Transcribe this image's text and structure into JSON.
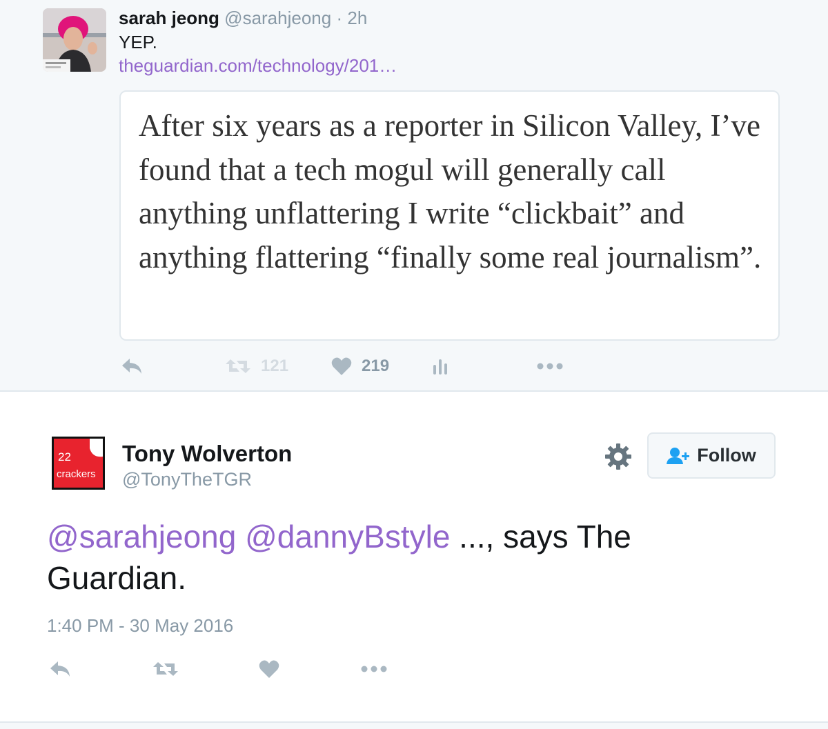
{
  "quoted_tweet": {
    "author_name": "sarah jeong",
    "author_handle": "@sarahjeong",
    "separator": "·",
    "time_ago": "2h",
    "text": "YEP.",
    "link": "theguardian.com/technology/201…",
    "card_quote": "After six years as a reporter in Silicon Valley, I’ve found that a tech mogul will generally call anything unflattering I write “clickbait” and anything flattering “finally some real journalism”.",
    "retweet_count": "121",
    "like_count": "219",
    "icons": [
      "reply-icon",
      "retweet-icon",
      "heart-icon",
      "analytics-icon",
      "more-icon"
    ]
  },
  "main_tweet": {
    "avatar": {
      "number": "22",
      "word": "crackers",
      "bg_color": "#e8232e"
    },
    "author_name": "Tony Wolverton",
    "author_handle": "@TonyTheTGR",
    "follow_label": "Follow",
    "mentions": [
      "@sarahjeong",
      "@dannyBstyle"
    ],
    "text_rest": " ..., says The Guardian.",
    "timestamp": "1:40 PM - 30 May 2016",
    "icons": [
      "reply-icon",
      "retweet-icon",
      "heart-icon",
      "more-icon"
    ]
  },
  "colors": {
    "link": "#9266cc",
    "muted": "#8899a6",
    "text": "#14171a",
    "follow_icon": "#1da1f2",
    "liked_heart": "#aab8c2"
  }
}
